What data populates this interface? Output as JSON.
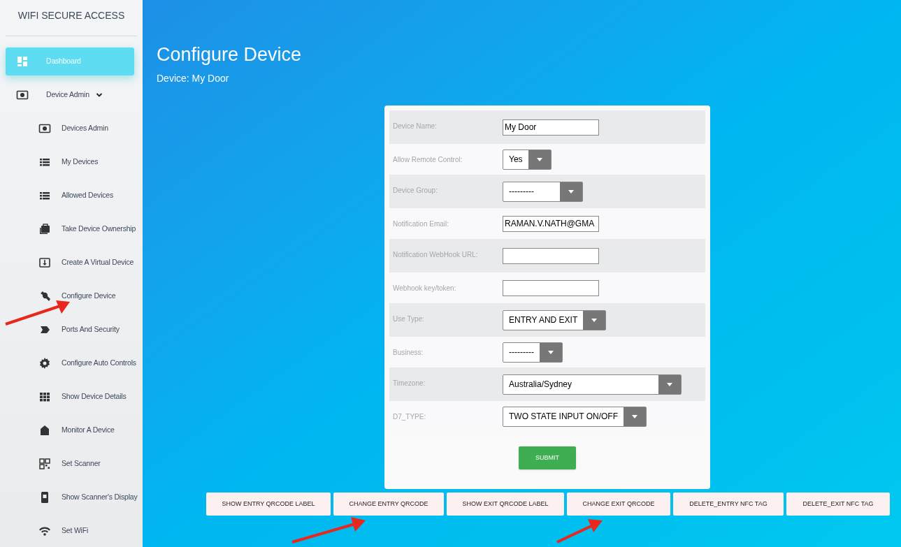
{
  "sidebar": {
    "brand": "WIFI SECURE ACCESS",
    "items": [
      {
        "label": "Dashboard",
        "selected": true
      },
      {
        "label": "Device Admin",
        "selected": false,
        "expanded": true,
        "children": [
          {
            "label": "Devices Admin",
            "selected": false
          },
          {
            "label": "My Devices",
            "selected": false
          },
          {
            "label": "Allowed Devices",
            "selected": false
          },
          {
            "label": "Take Device Ownership",
            "selected": false
          },
          {
            "label": "Create A Virtual Device",
            "selected": false
          },
          {
            "label": "Configure Device",
            "selected": false
          },
          {
            "label": "Ports And Security",
            "selected": false
          },
          {
            "label": "Configure Auto Controls",
            "selected": false
          },
          {
            "label": "Show Device Details",
            "selected": false
          },
          {
            "label": "Monitor A Device",
            "selected": false
          },
          {
            "label": "Set Scanner",
            "selected": false
          },
          {
            "label": "Show Scanner's Display",
            "selected": false
          },
          {
            "label": "Set WiFi",
            "selected": false
          }
        ]
      }
    ]
  },
  "page": {
    "title": "Configure Device",
    "subtitle": "Device: My Door"
  },
  "form": {
    "fields": [
      {
        "kind": "text",
        "label": "Device Name:",
        "value": "My Door"
      },
      {
        "kind": "select",
        "label": "Allow Remote Control:",
        "value": "Yes"
      },
      {
        "kind": "select",
        "label": "Device Group:",
        "value": "---------"
      },
      {
        "kind": "text",
        "label": "Notification Email:",
        "value": "RAMAN.V.NATH@GMA"
      },
      {
        "kind": "text",
        "label": "Notification WebHook URL:"
      },
      {
        "kind": "text",
        "label": "Webhook key/token:"
      },
      {
        "kind": "select",
        "label": "Use Type:",
        "value": "ENTRY AND EXIT"
      },
      {
        "kind": "select",
        "label": "Business:",
        "value": "---------"
      },
      {
        "kind": "select",
        "label": "Timezone:",
        "value": "Australia/Sydney"
      },
      {
        "kind": "select",
        "label": "D7_TYPE:",
        "value": "TWO STATE INPUT ON/OFF"
      }
    ],
    "submit": "SUBMIT"
  },
  "actions": [
    "SHOW ENTRY QRCODE LABEL",
    "CHANGE ENTRY QRCODE",
    "SHOW EXIT QRCODE LABEL",
    "CHANGE EXIT QRCODE",
    "DELETE_ENTRY NFC TAG",
    "DELETE_EXIT NFC TAG"
  ]
}
